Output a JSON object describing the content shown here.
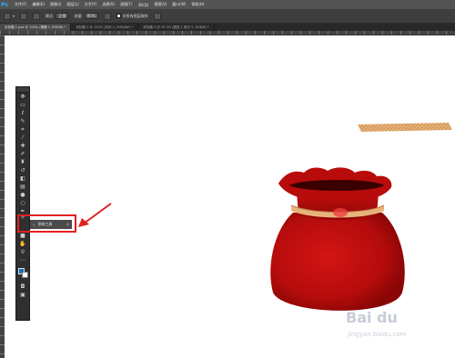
{
  "app": {
    "logo": "Ps"
  },
  "menu": [
    "文件(F)",
    "编辑(E)",
    "图像(I)",
    "图层(L)",
    "文字(Y)",
    "选择(S)",
    "滤镜(T)",
    "3D(D)",
    "视图(V)",
    "窗口(W)",
    "帮助(H)"
  ],
  "options": {
    "mode_label": "模式:",
    "mode_value": "正常",
    "opacity_label": "不透明度:",
    "opacity_value": "100%",
    "flow_label": "流量:",
    "flow_value": "95%",
    "sample_label": "对所有图层取样"
  },
  "tabs": [
    {
      "label": "未标题-1.psd @ 100% (椭圆 1, RGB/8) *",
      "active": true
    },
    {
      "label": "未标题-2 @ 100% (形状 2, RGB/8#) *",
      "active": false
    },
    {
      "label": "未标题-3 @ 33.3% (图层 1 拷贝 5, RGB/8) *",
      "active": false
    }
  ],
  "flyout": {
    "label": "涂抹工具",
    "shortcut": "R"
  },
  "watermark": {
    "brand": "Bai du",
    "sub": "jingyan.baidu.com"
  },
  "colors": {
    "foreground": "#1b6fb5",
    "background": "#ffffff",
    "highlight": "#e02020",
    "pouch": "#b80b0b",
    "rope": "#e7b37a"
  }
}
